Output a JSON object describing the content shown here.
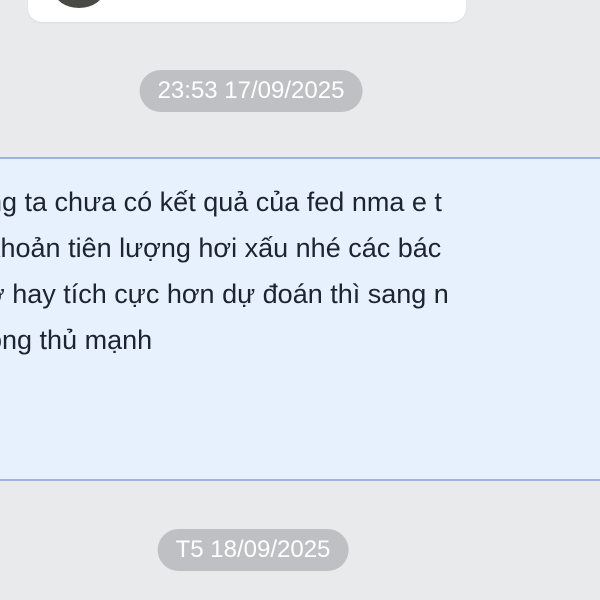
{
  "timestamps": {
    "first": "23:53 17/09/2025",
    "second": "T5 18/09/2025"
  },
  "message": {
    "lines": [
      "ng ta chưa có kết quả của fed nma e t",
      " khoản tiên lượng hơi xấu nhé các bác",
      "ờ hay tích cực hơn dự đoán thì sang n",
      "ong thủ mạnh"
    ]
  },
  "colors": {
    "background": "#e9eaec",
    "bubble_fill": "#e6f1fd",
    "bubble_border": "#9fb3e2",
    "timestamp_pill": "#bfc0c4"
  }
}
